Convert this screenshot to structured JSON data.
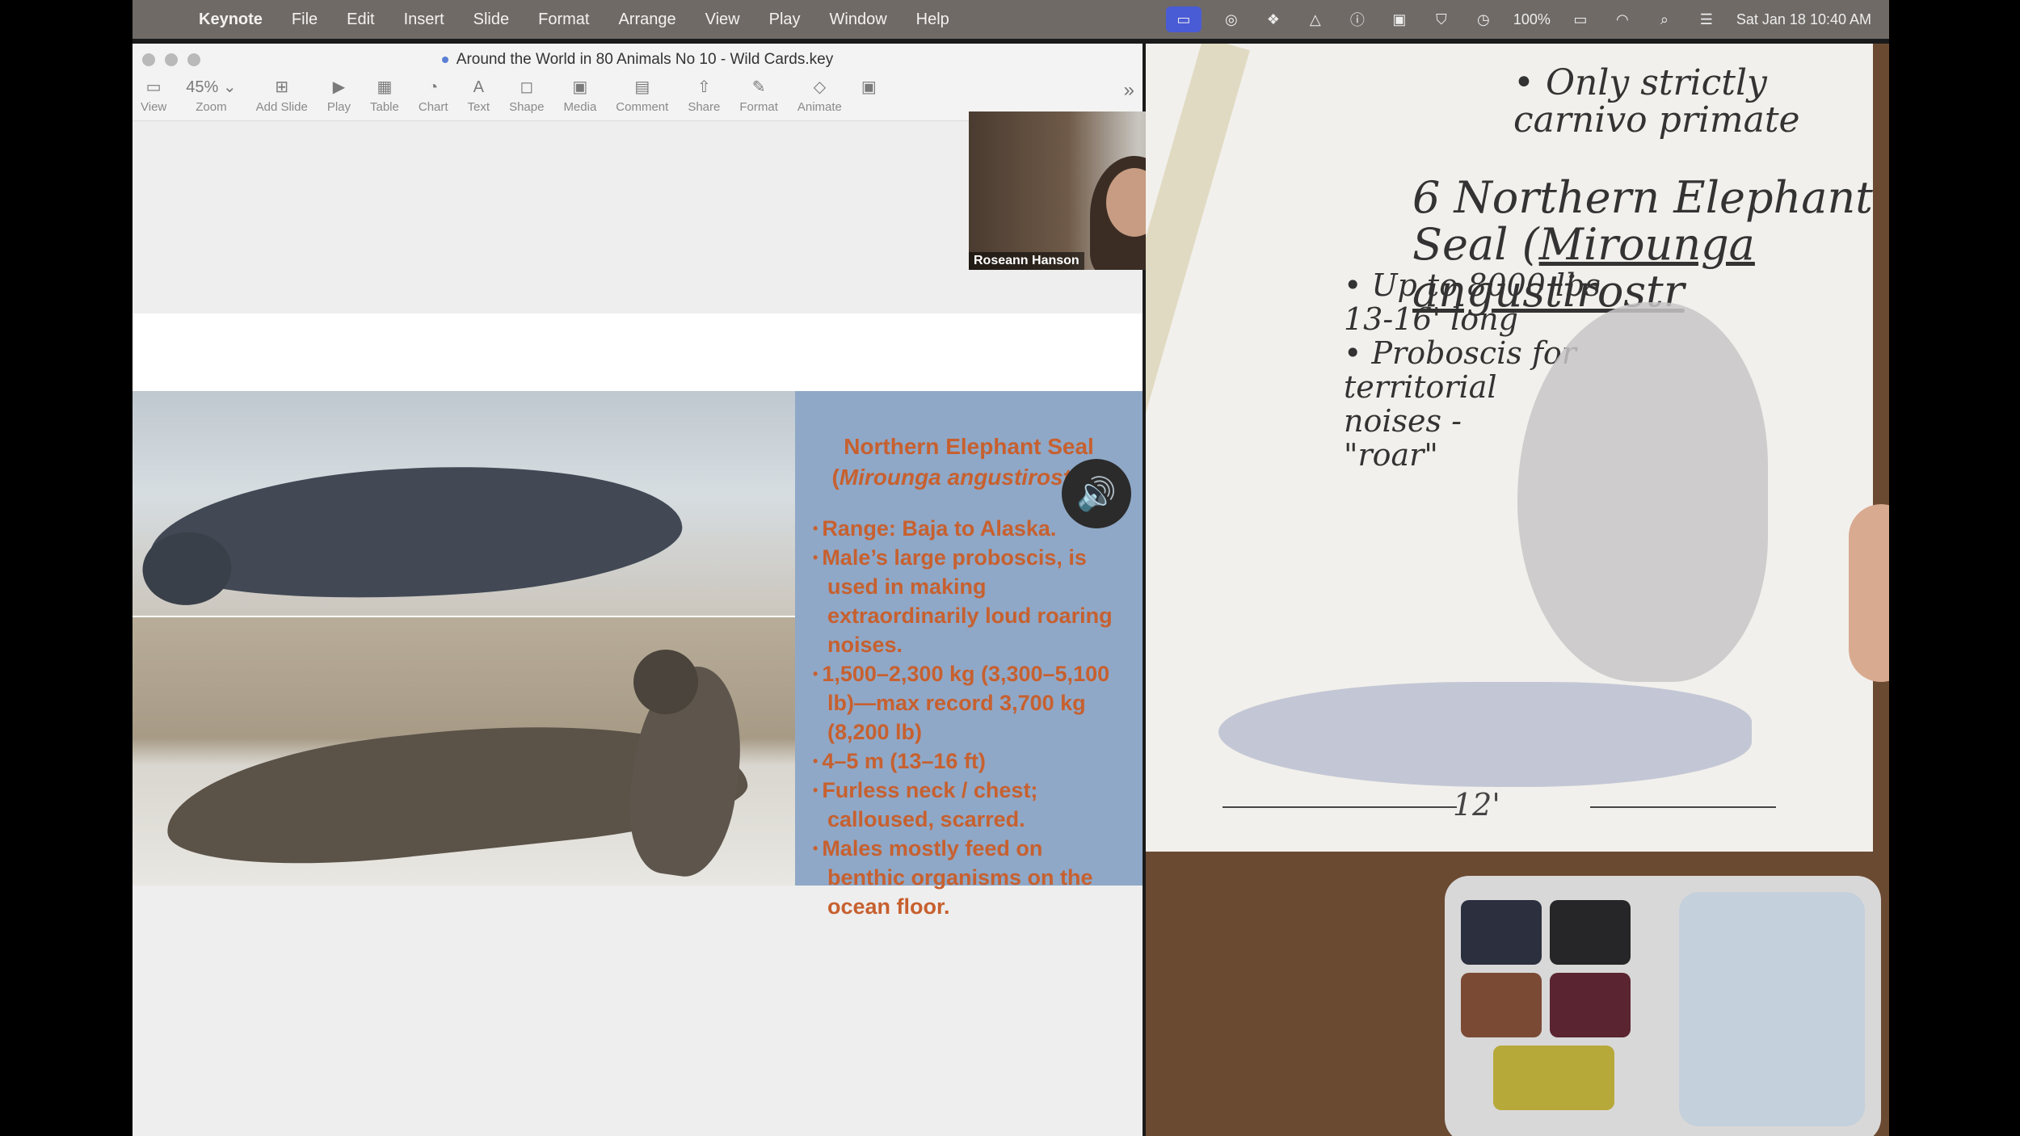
{
  "menubar": {
    "app_name": "Keynote",
    "items": [
      "File",
      "Edit",
      "Insert",
      "Slide",
      "Format",
      "Arrange",
      "View",
      "Play",
      "Window",
      "Help"
    ],
    "battery": "100%",
    "datetime": "Sat Jan 18  10:40 AM",
    "status_icons": [
      "screen-share-icon",
      "creative-cloud-icon",
      "dropbox-icon",
      "drive-icon",
      "password-icon",
      "notes-icon",
      "shield-icon",
      "time-machine-icon",
      "battery-icon",
      "wifi-icon",
      "search-icon",
      "control-center-icon"
    ]
  },
  "keynote": {
    "title": "Around the World in 80 Animals No 10 - Wild Cards.key",
    "toolbar": [
      {
        "icon": "sidebar-icon",
        "label": "View",
        "glyph": "▭"
      },
      {
        "icon": "zoom-icon",
        "label": "Zoom",
        "glyph": "45% ⌄"
      },
      {
        "icon": "add-slide-icon",
        "label": "Add Slide",
        "glyph": "⊞"
      },
      {
        "icon": "play-icon",
        "label": "Play",
        "glyph": "▶"
      },
      {
        "icon": "table-icon",
        "label": "Table",
        "glyph": "▦"
      },
      {
        "icon": "chart-icon",
        "label": "Chart",
        "glyph": "◔"
      },
      {
        "icon": "text-icon",
        "label": "Text",
        "glyph": "A"
      },
      {
        "icon": "shape-icon",
        "label": "Shape",
        "glyph": "◻"
      },
      {
        "icon": "media-icon",
        "label": "Media",
        "glyph": "▣"
      },
      {
        "icon": "comment-icon",
        "label": "Comment",
        "glyph": "▤"
      },
      {
        "icon": "share-icon",
        "label": "Share",
        "glyph": "⇧"
      },
      {
        "icon": "format-icon",
        "label": "Format",
        "glyph": "✎"
      },
      {
        "icon": "animate-icon",
        "label": "Animate",
        "glyph": "◇"
      },
      {
        "icon": "document-icon",
        "label": "",
        "glyph": "▣"
      }
    ],
    "more": "»"
  },
  "slide": {
    "heading_common": "Northern Elephant Seal",
    "heading_scientific": "Mirounga angustirostris",
    "bullets": [
      "Range: Baja to Alaska.",
      "Male’s large proboscis, is used in making extraordinarily loud roaring noises.",
      "1,500–2,300 kg (3,300–5,100 lb)—max record 3,700 kg (8,200 lb)",
      "4–5 m (13–16 ft)",
      "Furless neck / chest; calloused, scarred.",
      "Males mostly feed on benthic organisms on the ocean floor."
    ]
  },
  "webcam": {
    "participant_name": "Roseann Hanson"
  },
  "sketch": {
    "top_note": "• Only strictly carnivo primate",
    "title_number": "6",
    "title_line1": "Northern Elephant",
    "title_line2a": "Seal (",
    "title_line2b": "Mirounga angustirostr",
    "notes": [
      "• Up to 8000 lbs",
      "  13-16' long",
      "• Proboscis for",
      "  territorial",
      "  noises -",
      "  \"roar\""
    ],
    "scale_label": "12'"
  }
}
